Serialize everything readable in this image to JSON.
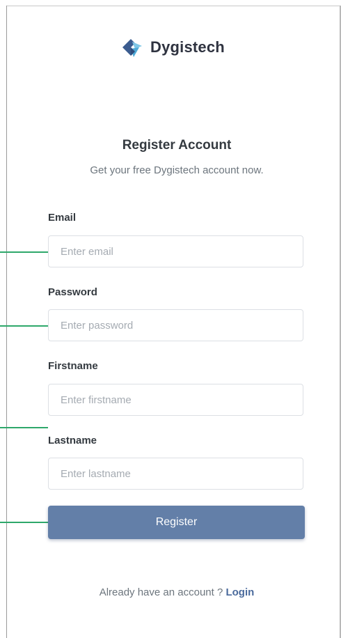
{
  "brand": {
    "name": "Dygistech",
    "logo_colors": [
      "#3b5c8f",
      "#5bb6de"
    ]
  },
  "header": {
    "title": "Register Account",
    "subtitle": "Get your free Dygistech account now."
  },
  "form": {
    "email": {
      "label": "Email",
      "placeholder": "Enter email"
    },
    "password": {
      "label": "Password",
      "placeholder": "Enter password"
    },
    "firstname": {
      "label": "Firstname",
      "placeholder": "Enter firstname"
    },
    "lastname": {
      "label": "Lastname",
      "placeholder": "Enter lastname"
    },
    "submit_label": "Register"
  },
  "footer": {
    "prompt": "Already have an account ? ",
    "login_label": "Login"
  },
  "colors": {
    "button": "#637fa8",
    "connector": "#2ea86a",
    "link": "#4a6a9c"
  }
}
